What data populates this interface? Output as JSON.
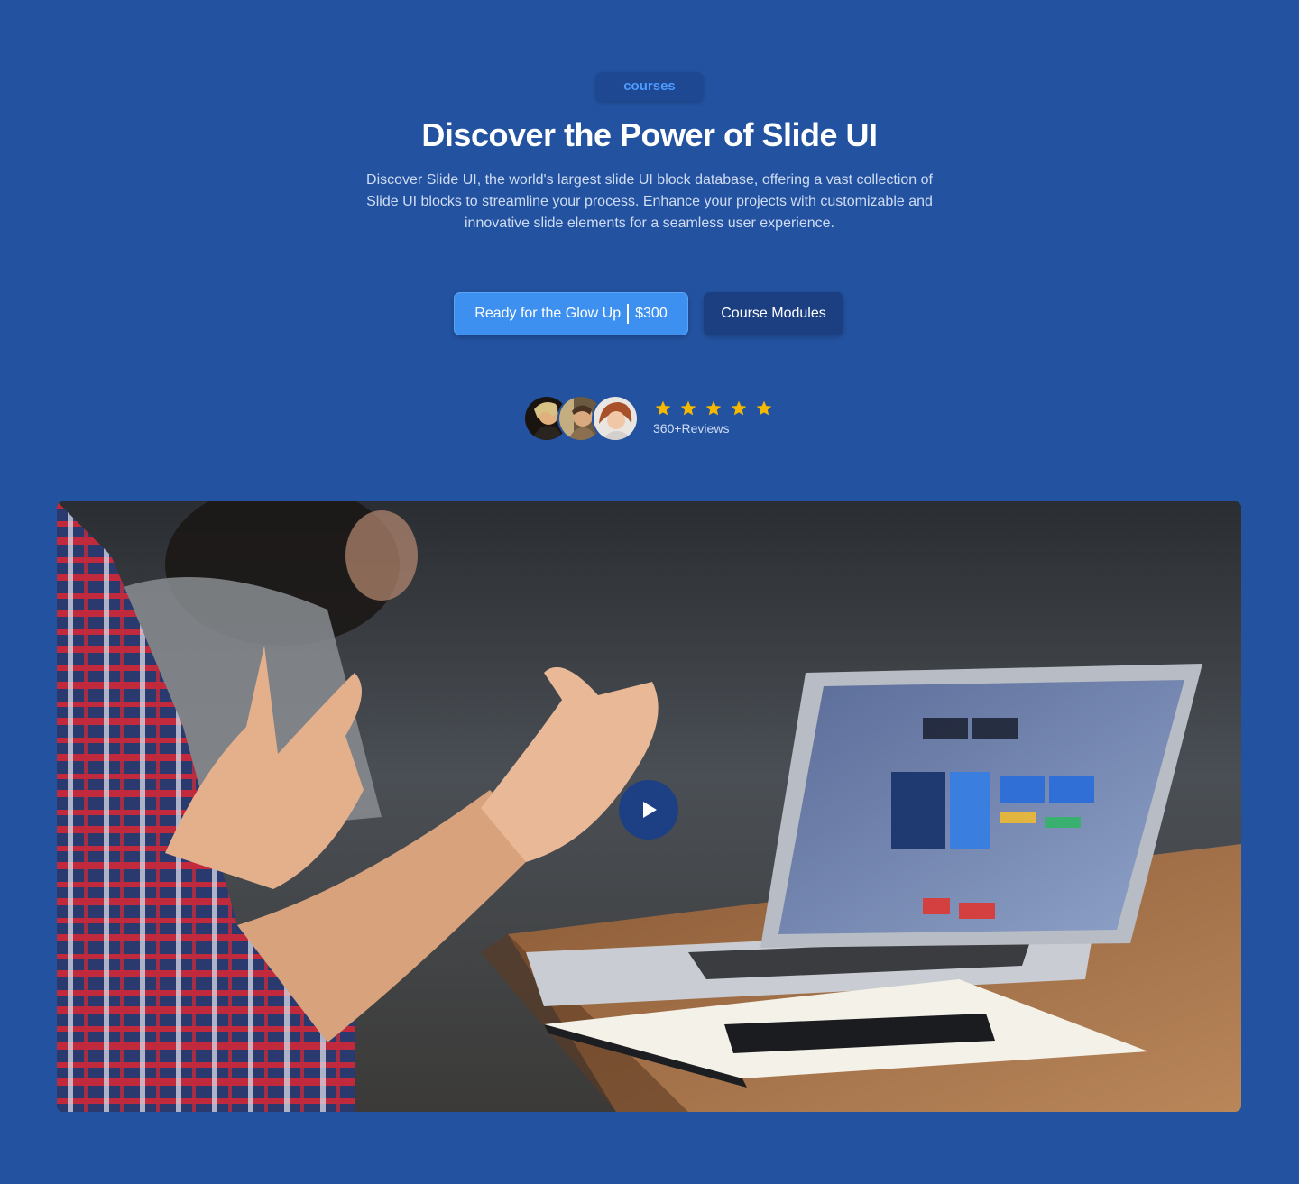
{
  "hero": {
    "badge": "courses",
    "title": "Discover the Power of Slide UI",
    "description": "Discover Slide UI, the world's largest slide UI block database, offering a vast collection of Slide UI blocks to streamline your process. Enhance your projects with customizable and innovative slide elements for a seamless user experience."
  },
  "buttons": {
    "primary_label": "Ready for the Glow Up",
    "primary_price": "$300",
    "secondary_label": "Course Modules"
  },
  "rating": {
    "stars": 5,
    "reviews_label": "360+Reviews",
    "star_color": "#f5b800"
  },
  "video": {
    "play_icon": "play-icon"
  },
  "colors": {
    "background": "#2352a0",
    "primary_button": "#3d8ff0",
    "secondary_button": "#1c3f82",
    "badge_text": "#4d9bff"
  }
}
